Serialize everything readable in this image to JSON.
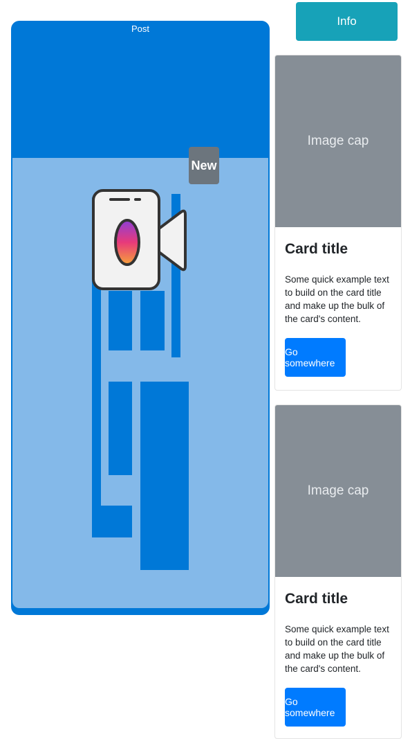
{
  "post": {
    "header_label": "Post",
    "badge": "New"
  },
  "info_button": {
    "label": "Info"
  },
  "cards": [
    {
      "image_cap": "Image cap",
      "title": "Card title",
      "text": "Some quick example text to build on the card title and make up the bulk of the card's content.",
      "button_label": "Go somewhere"
    },
    {
      "image_cap": "Image cap",
      "title": "Card title",
      "text": "Some quick example text to build on the card title and make up the bulk of the card's content.",
      "button_label": "Go somewhere"
    }
  ],
  "colors": {
    "primary_blue": "#0078d7",
    "light_blue": "#84b9e9",
    "info": "#17a2b8",
    "secondary": "#6c757d",
    "image_cap_gray": "#868e96",
    "button_blue": "#007bff"
  },
  "icons": {
    "camera": "video-camera-icon"
  }
}
